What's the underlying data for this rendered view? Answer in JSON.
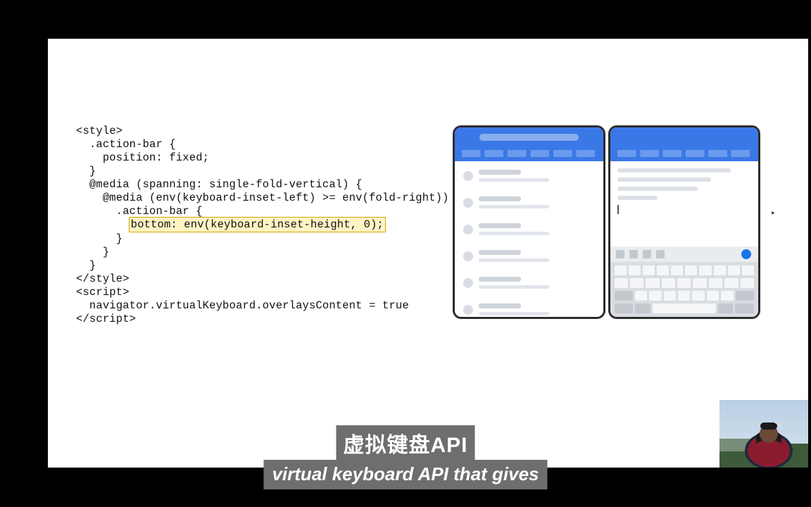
{
  "code": {
    "line1": "<style>",
    "line2": "  .action-bar {",
    "line3": "    position: fixed;",
    "line4": "  }",
    "line5": "  @media (spanning: single-fold-vertical) {",
    "line6": "    @media (env(keyboard-inset-left) >= env(fold-right)) {",
    "line7": "      .action-bar {",
    "line8_pre": "        ",
    "line8_hl": "bottom: env(keyboard-inset-height, 0);",
    "line9": "      }",
    "line10": "    }",
    "line11": "  }",
    "line12": "</style>",
    "line13": "<script>",
    "line14": "  navigator.virtualKeyboard.overlaysContent = true",
    "line15": "</script>"
  },
  "captions": {
    "cn": "虚拟键盘API",
    "en": "virtual keyboard API that gives"
  },
  "illustration": {
    "left_screen": "email-list",
    "right_screen": "compose-with-keyboard"
  }
}
